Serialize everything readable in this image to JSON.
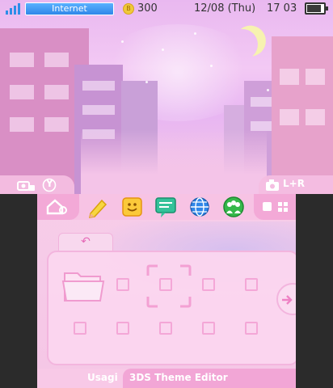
{
  "status_bar": {
    "connection_label": "Internet",
    "coins": "300",
    "coin_glyph": "B",
    "date": "12/08 (Thu)",
    "time": "17 03"
  },
  "top_tabs": {
    "left_label": "Y",
    "right_label": "L+R"
  },
  "toolbar": {
    "icons": [
      "home-settings-icon",
      "pencil-icon",
      "smiley-icon",
      "chat-icon",
      "globe-icon",
      "friends-icon",
      "grid-view-icon"
    ]
  },
  "home_menu": {
    "back_label": "↶"
  },
  "footer": {
    "user_name": "Usagi",
    "theme_name": "3DS Theme Editor"
  },
  "colors": {
    "accent": "#f2a6d6",
    "status_blue": "#2f86e8"
  }
}
